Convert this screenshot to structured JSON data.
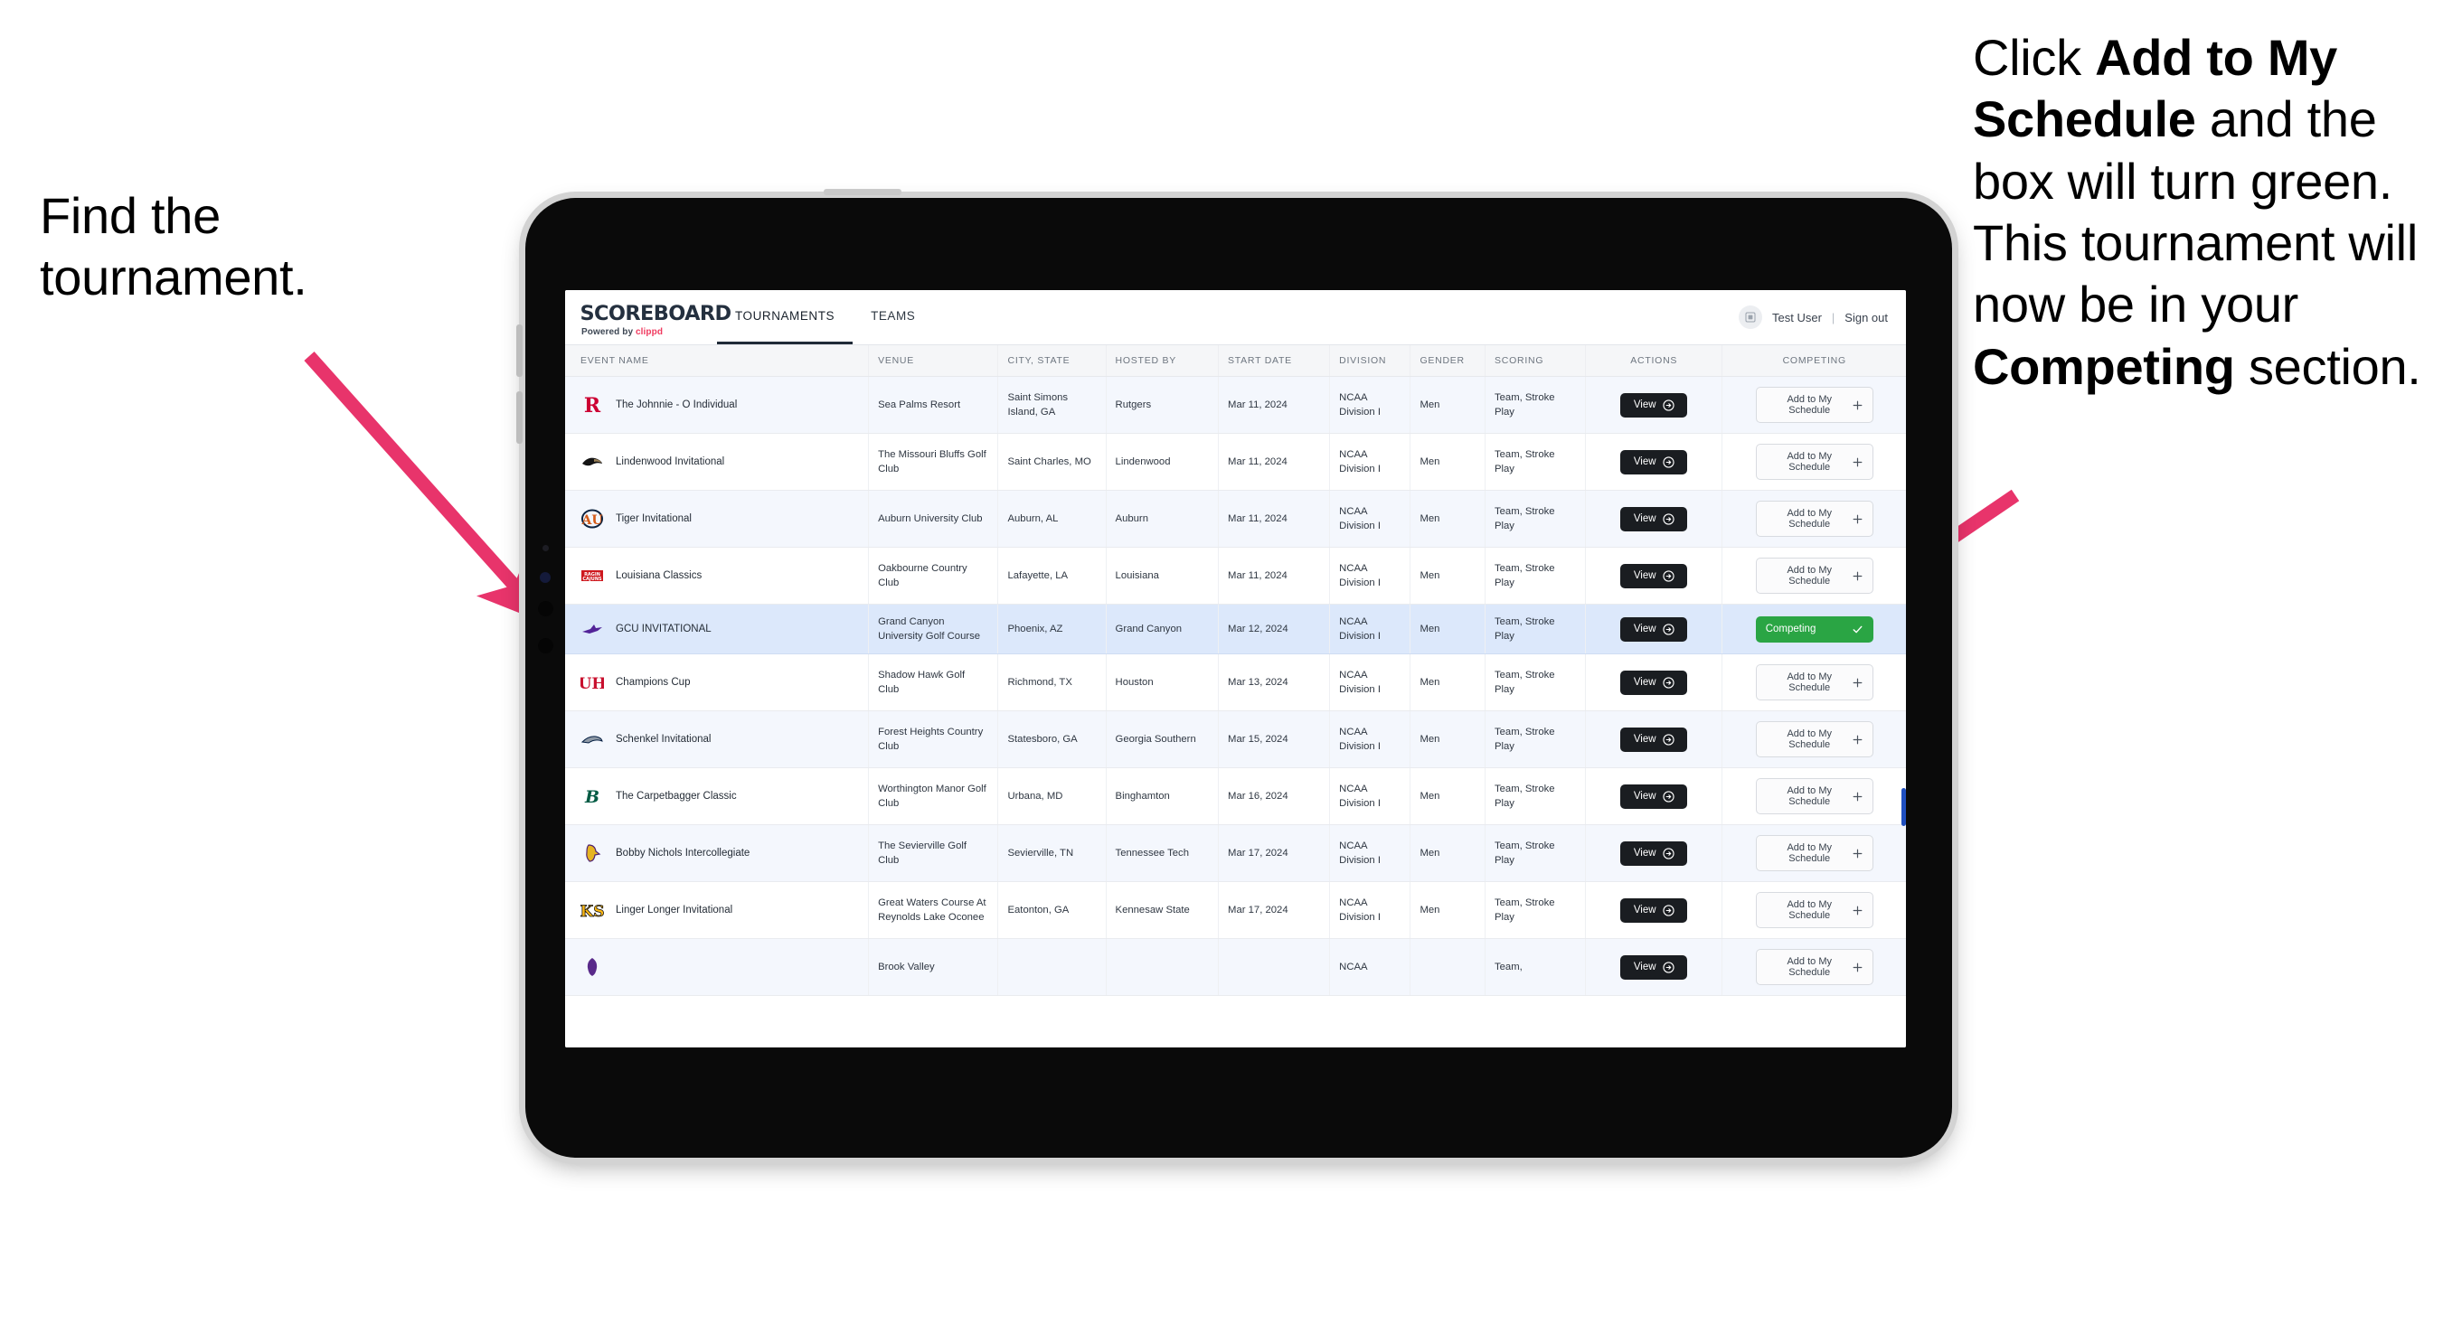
{
  "annotations": {
    "left": "Find the tournament.",
    "right_parts": [
      {
        "t": "Click ",
        "b": false
      },
      {
        "t": "Add to My Schedule",
        "b": true
      },
      {
        "t": " and the box will turn green. This tournament will now be in your ",
        "b": false
      },
      {
        "t": "Competing",
        "b": true
      },
      {
        "t": " section.",
        "b": false
      }
    ],
    "arrow_color": "#E8346B"
  },
  "app": {
    "brand": {
      "title": "SCOREBOARD",
      "sub_prefix": "Powered by ",
      "sub_brand": "clippd"
    },
    "nav": [
      {
        "label": "TOURNAMENTS",
        "active": true
      },
      {
        "label": "TEAMS",
        "active": false
      }
    ],
    "account": {
      "avatar_icon": "user-avatar-icon",
      "user": "Test User",
      "separator": "|",
      "signout": "Sign out"
    },
    "table": {
      "columns": [
        "EVENT NAME",
        "VENUE",
        "CITY, STATE",
        "HOSTED BY",
        "START DATE",
        "DIVISION",
        "GENDER",
        "SCORING",
        "ACTIONS",
        "COMPETING"
      ],
      "buttons": {
        "view": "View",
        "add": "Add to My Schedule",
        "competing": "Competing",
        "view_icon": "arrow-right-circle-icon",
        "add_icon": "plus-icon",
        "competing_icon": "check-icon"
      },
      "rows": [
        {
          "logo": "rutgers-r-logo",
          "logo_color": "#CC0033",
          "event": "The Johnnie - O Individual",
          "venue": "Sea Palms Resort",
          "city": "Saint Simons Island, GA",
          "host": "Rutgers",
          "date": "Mar 11, 2024",
          "division": "NCAA Division I",
          "gender": "Men",
          "scoring": "Team, Stroke Play",
          "competing": false
        },
        {
          "logo": "lindenwood-lion-logo",
          "logo_color": "#000000",
          "event": "Lindenwood Invitational",
          "venue": "The Missouri Bluffs Golf Club",
          "city": "Saint Charles, MO",
          "host": "Lindenwood",
          "date": "Mar 11, 2024",
          "division": "NCAA Division I",
          "gender": "Men",
          "scoring": "Team, Stroke Play",
          "competing": false
        },
        {
          "logo": "auburn-au-logo",
          "logo_color": "#0C2340",
          "event": "Tiger Invitational",
          "venue": "Auburn University Club",
          "city": "Auburn, AL",
          "host": "Auburn",
          "date": "Mar 11, 2024",
          "division": "NCAA Division I",
          "gender": "Men",
          "scoring": "Team, Stroke Play",
          "competing": false
        },
        {
          "logo": "ragin-cajuns-logo",
          "logo_color": "#CE181E",
          "event": "Louisiana Classics",
          "venue": "Oakbourne Country Club",
          "city": "Lafayette, LA",
          "host": "Louisiana",
          "date": "Mar 11, 2024",
          "division": "NCAA Division I",
          "gender": "Men",
          "scoring": "Team, Stroke Play",
          "competing": false
        },
        {
          "logo": "gcu-lope-logo",
          "logo_color": "#522398",
          "event": "GCU INVITATIONAL",
          "venue": "Grand Canyon University Golf Course",
          "city": "Phoenix, AZ",
          "host": "Grand Canyon",
          "date": "Mar 12, 2024",
          "division": "NCAA Division I",
          "gender": "Men",
          "scoring": "Team, Stroke Play",
          "competing": true,
          "selected": true
        },
        {
          "logo": "houston-uh-logo",
          "logo_color": "#C8102E",
          "event": "Champions Cup",
          "venue": "Shadow Hawk Golf Club",
          "city": "Richmond, TX",
          "host": "Houston",
          "date": "Mar 13, 2024",
          "division": "NCAA Division I",
          "gender": "Men",
          "scoring": "Team, Stroke Play",
          "competing": false
        },
        {
          "logo": "georgia-southern-eagle-logo",
          "logo_color": "#041E42",
          "event": "Schenkel Invitational",
          "venue": "Forest Heights Country Club",
          "city": "Statesboro, GA",
          "host": "Georgia Southern",
          "date": "Mar 15, 2024",
          "division": "NCAA Division I",
          "gender": "Men",
          "scoring": "Team, Stroke Play",
          "competing": false
        },
        {
          "logo": "binghamton-b-logo",
          "logo_color": "#005A43",
          "event": "The Carpetbagger Classic",
          "venue": "Worthington Manor Golf Club",
          "city": "Urbana, MD",
          "host": "Binghamton",
          "date": "Mar 16, 2024",
          "division": "NCAA Division I",
          "gender": "Men",
          "scoring": "Team, Stroke Play",
          "competing": false
        },
        {
          "logo": "tennessee-tech-eagle-logo",
          "logo_color": "#4F2170",
          "event": "Bobby Nichols Intercollegiate",
          "venue": "The Sevierville Golf Club",
          "city": "Sevierville, TN",
          "host": "Tennessee Tech",
          "date": "Mar 17, 2024",
          "division": "NCAA Division I",
          "gender": "Men",
          "scoring": "Team, Stroke Play",
          "competing": false
        },
        {
          "logo": "kennesaw-state-ks-logo",
          "logo_color": "#FDB913",
          "event": "Linger Longer Invitational",
          "venue": "Great Waters Course At Reynolds Lake Oconee",
          "city": "Eatonton, GA",
          "host": "Kennesaw State",
          "date": "Mar 17, 2024",
          "division": "NCAA Division I",
          "gender": "Men",
          "scoring": "Team, Stroke Play",
          "competing": false
        },
        {
          "logo": "ecu-pirate-logo",
          "logo_color": "#592A8A",
          "event": "",
          "venue": "Brook Valley",
          "city": "",
          "host": "",
          "date": "",
          "division": "NCAA",
          "gender": "",
          "scoring": "Team,",
          "competing": false,
          "clipped": true
        }
      ]
    }
  }
}
